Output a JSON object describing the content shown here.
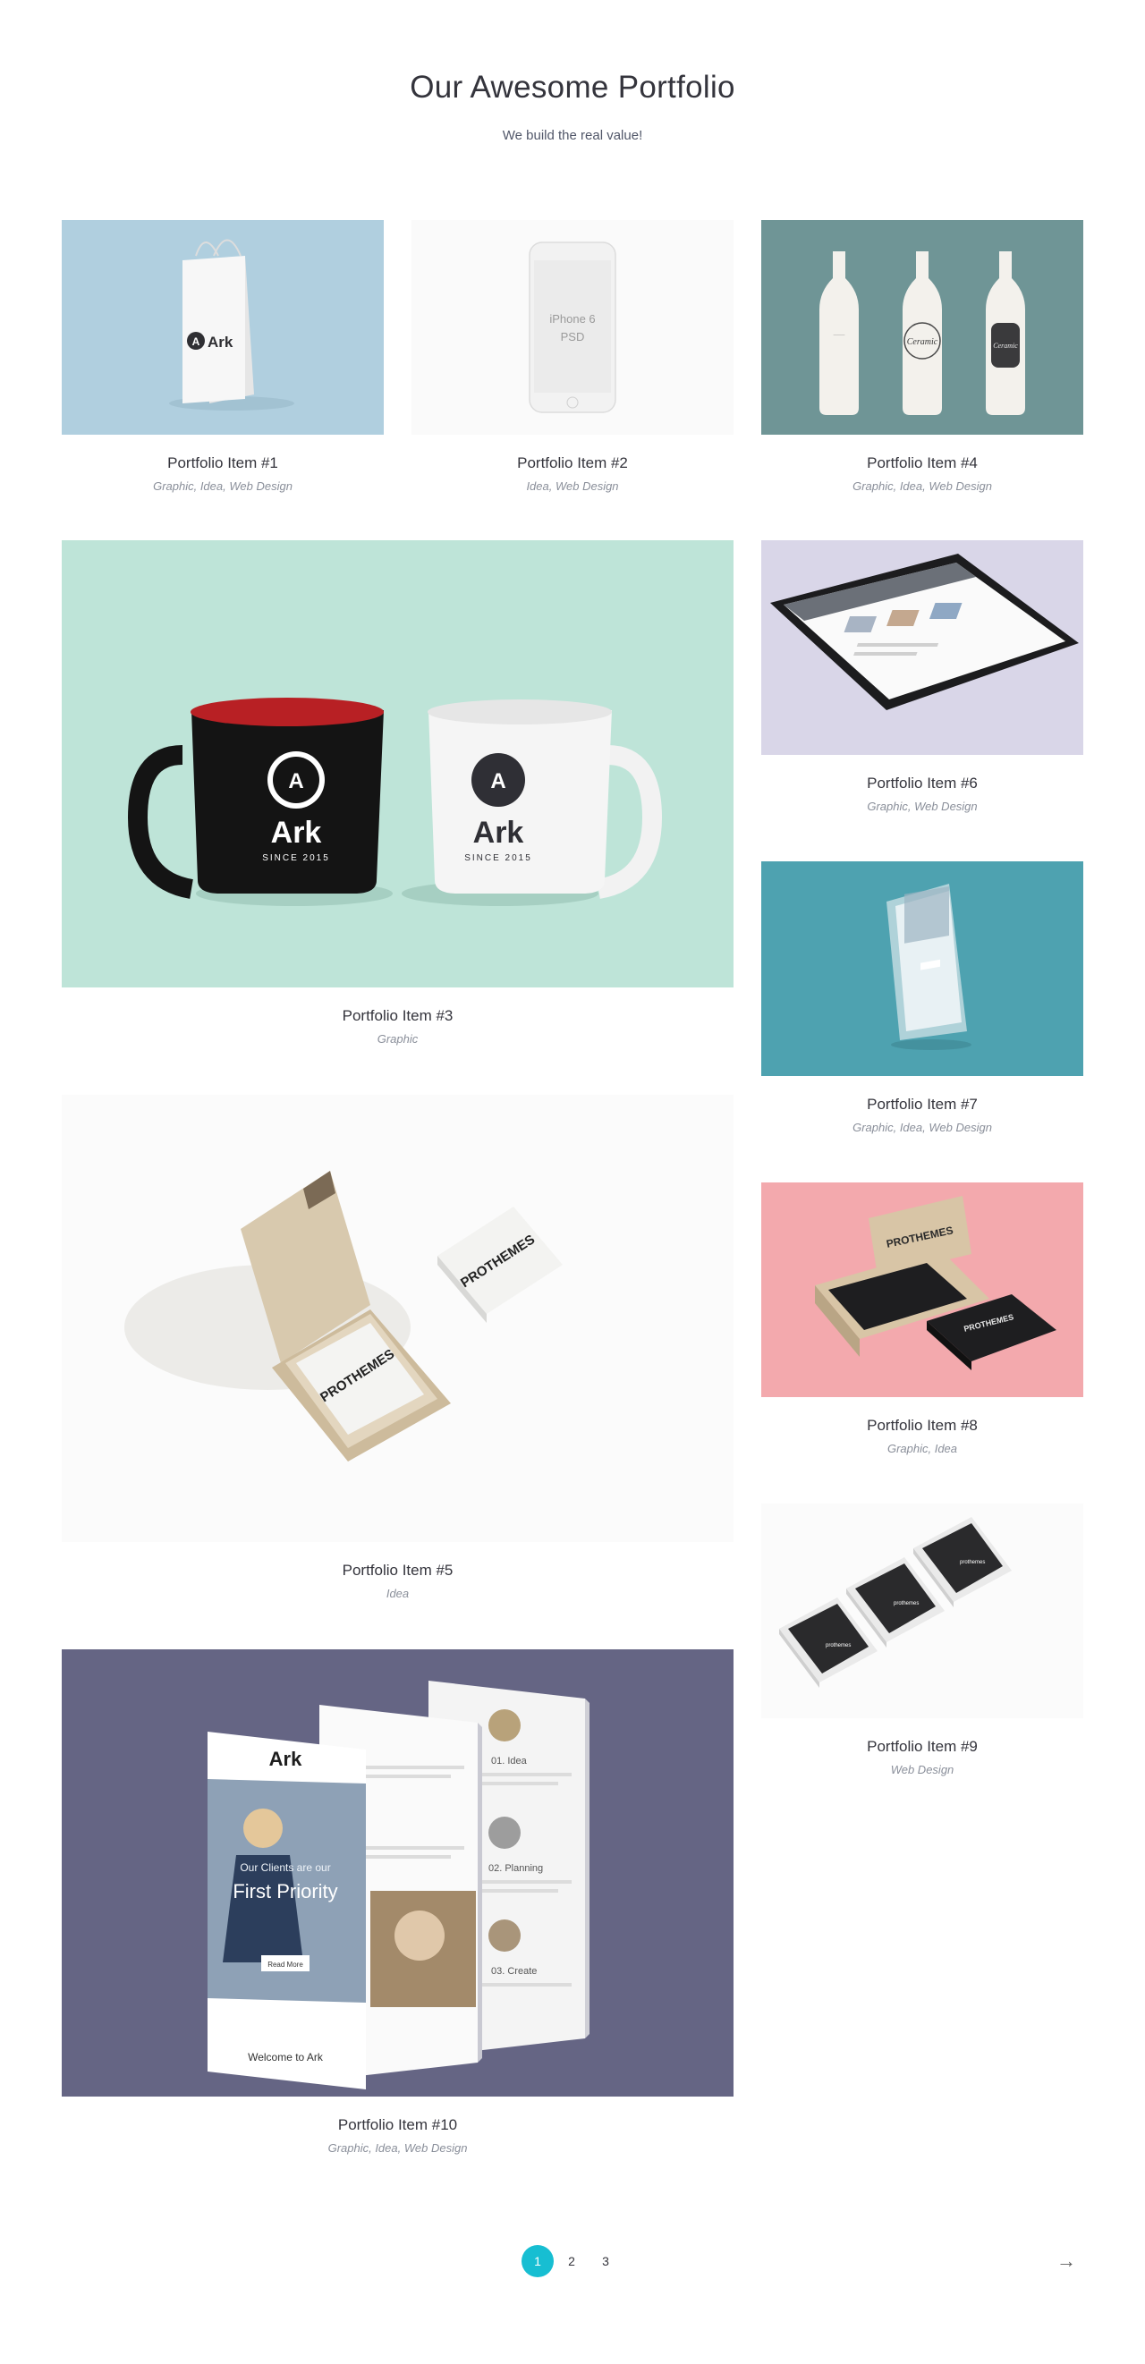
{
  "header": {
    "title": "Our Awesome Portfolio",
    "subtitle": "We build the real value!"
  },
  "items": [
    {
      "title": "Portfolio Item #1",
      "tags": "Graphic, Idea, Web Design",
      "thumb_text": "Ark",
      "bg": "#b0cfdf"
    },
    {
      "title": "Portfolio Item #2",
      "tags": "Idea, Web Design",
      "thumb_text": "iPhone 6\nPSD",
      "bg": "#fafafa"
    },
    {
      "title": "Portfolio Item #4",
      "tags": "Graphic, Idea, Web Design",
      "thumb_text": "Ceramic",
      "bg": "#6f9596"
    },
    {
      "title": "Portfolio Item #3",
      "tags": "Graphic",
      "thumb_text": "Ark",
      "thumb_subtext": "SINCE 2015",
      "bg": "#bee4d8"
    },
    {
      "title": "Portfolio Item #6",
      "tags": "Graphic, Web Design",
      "bg": "#d9d6e8"
    },
    {
      "title": "Portfolio Item #7",
      "tags": "Graphic, Idea, Web Design",
      "bg": "#4ea2b0"
    },
    {
      "title": "Portfolio Item #5",
      "tags": "Idea",
      "thumb_text": "PROTHEMES",
      "bg": "#fbfbfb"
    },
    {
      "title": "Portfolio Item #8",
      "tags": "Graphic, Idea",
      "thumb_text": "PROTHEMES",
      "bg": "#f3a9ad"
    },
    {
      "title": "Portfolio Item #9",
      "tags": "Web Design",
      "bg": "#fbfbfb"
    },
    {
      "title": "Portfolio Item #10",
      "tags": "Graphic, Idea, Web Design",
      "thumb_text": "Ark",
      "bg": "#656584",
      "mock": {
        "line1": "Our Clients are our",
        "line2": "First Priority",
        "button": "Read More",
        "footer": "Welcome to Ark",
        "steps": [
          "01. Idea",
          "02. Planning",
          "03. Create"
        ]
      }
    }
  ],
  "pagination": {
    "pages": [
      "1",
      "2",
      "3"
    ],
    "active": "1",
    "next_icon": "→"
  },
  "colors": {
    "accent": "#17bed2",
    "title": "#34343c",
    "tags": "#8a8f9a"
  }
}
